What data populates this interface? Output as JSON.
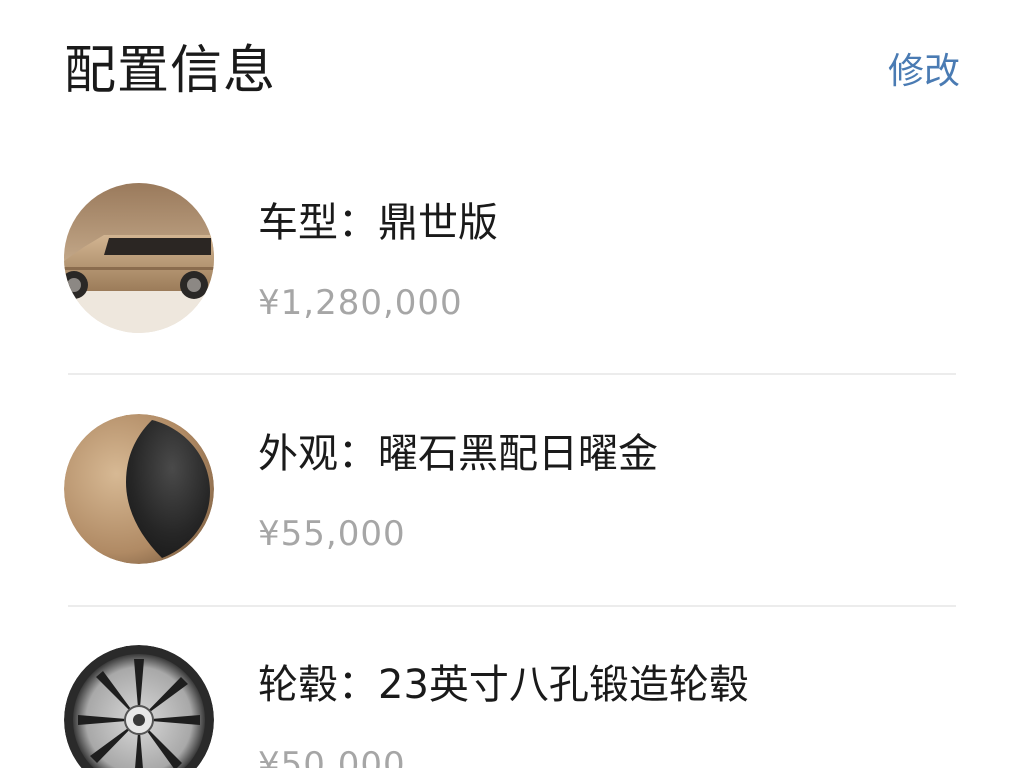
{
  "header": {
    "title": "配置信息",
    "edit_label": "修改"
  },
  "items": [
    {
      "title": "车型：鼎世版",
      "price": "¥1,280,000",
      "thumb_icon": "car-side-icon"
    },
    {
      "title": "外观：曜石黑配日曜金",
      "price": "¥55,000",
      "thumb_icon": "paint-swatch-icon"
    },
    {
      "title": "轮毂：23英寸八孔锻造轮毂",
      "price": "¥50,000",
      "thumb_icon": "wheel-icon"
    }
  ],
  "colors": {
    "accent": "#4a7bb3",
    "price_gray": "#a6a6a6",
    "divider": "#ececec",
    "car_body": "#b8956e",
    "paint_black": "#2a2a2a",
    "paint_gold": "#b8956e"
  }
}
